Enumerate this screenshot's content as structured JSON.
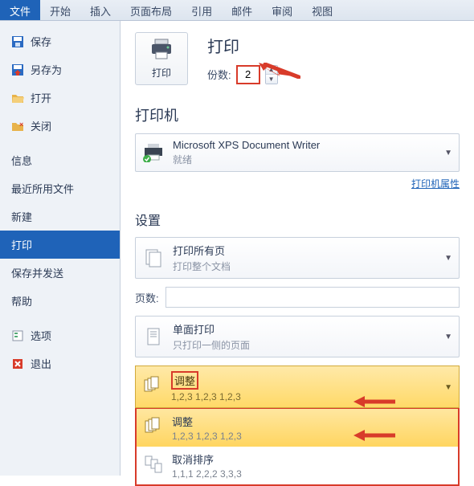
{
  "ribbon": {
    "tabs": [
      "文件",
      "开始",
      "插入",
      "页面布局",
      "引用",
      "邮件",
      "审阅",
      "视图"
    ]
  },
  "sidebar": {
    "save": "保存",
    "saveas": "另存为",
    "open": "打开",
    "close": "关闭",
    "info": "信息",
    "recent": "最近所用文件",
    "new": "新建",
    "print": "打印",
    "send": "保存并发送",
    "help": "帮助",
    "options": "选项",
    "exit": "退出"
  },
  "print": {
    "title": "打印",
    "button": "打印",
    "copies_label": "份数:",
    "copies_value": "2"
  },
  "printer": {
    "section": "打印机",
    "name": "Microsoft XPS Document Writer",
    "status": "就绪",
    "props": "打印机属性"
  },
  "settings": {
    "section": "设置",
    "scope_label": "打印所有页",
    "scope_sub": "打印整个文档",
    "pages_label": "页数:",
    "pages_value": "",
    "side_label": "单面打印",
    "side_sub": "只打印一侧的页面",
    "collate_label": "调整",
    "collate_sub": "1,2,3    1,2,3    1,2,3",
    "opt1_label": "调整",
    "opt1_sub": "1,2,3    1,2,3    1,2,3",
    "opt2_label": "取消排序",
    "opt2_sub": "1,1,1    2,2,2    3,3,3"
  }
}
